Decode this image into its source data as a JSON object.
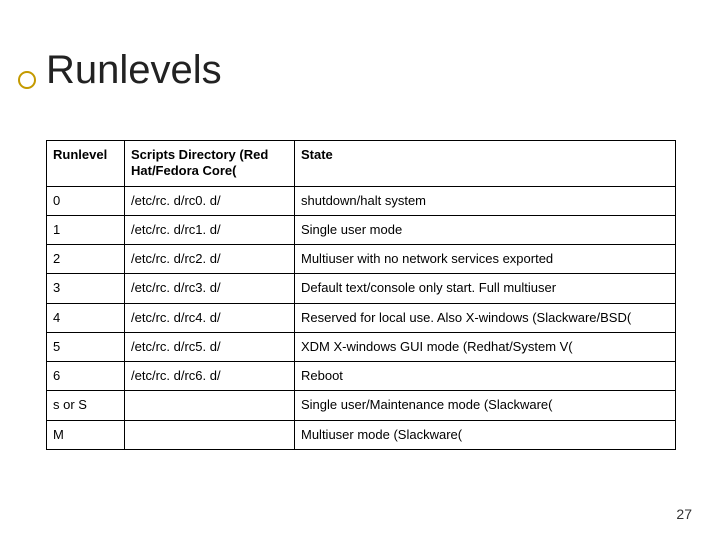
{
  "title": "Runlevels",
  "page_number": "27",
  "table": {
    "headers": {
      "runlevel": "Runlevel",
      "scripts": "Scripts Directory (Red Hat/Fedora Core(",
      "state": "State"
    },
    "rows": [
      {
        "runlevel": "0",
        "scripts": "/etc/rc. d/rc0. d/",
        "state": "shutdown/halt system"
      },
      {
        "runlevel": "1",
        "scripts": "/etc/rc. d/rc1. d/",
        "state": "Single user mode"
      },
      {
        "runlevel": "2",
        "scripts": "/etc/rc. d/rc2. d/",
        "state": "Multiuser with no network services exported"
      },
      {
        "runlevel": "3",
        "scripts": "/etc/rc. d/rc3. d/",
        "state": "Default text/console only start. Full multiuser"
      },
      {
        "runlevel": "4",
        "scripts": "/etc/rc. d/rc4. d/",
        "state": "Reserved for local use. Also X-windows (Slackware/BSD("
      },
      {
        "runlevel": "5",
        "scripts": "/etc/rc. d/rc5. d/",
        "state": "XDM X-windows GUI mode (Redhat/System V("
      },
      {
        "runlevel": "6",
        "scripts": "/etc/rc. d/rc6. d/",
        "state": "Reboot"
      },
      {
        "runlevel": "s or S",
        "scripts": "",
        "state": "Single user/Maintenance mode (Slackware("
      },
      {
        "runlevel": "M",
        "scripts": "",
        "state": "Multiuser mode (Slackware("
      }
    ]
  }
}
